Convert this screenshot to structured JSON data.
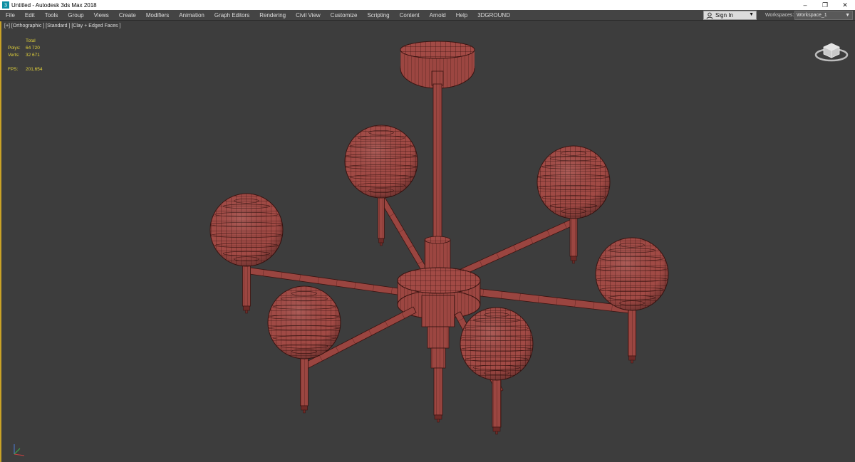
{
  "window": {
    "title": "Untitled - Autodesk 3ds Max 2018",
    "controls": [
      "–",
      "❐",
      "✕"
    ]
  },
  "menu": {
    "items": [
      "File",
      "Edit",
      "Tools",
      "Group",
      "Views",
      "Create",
      "Modifiers",
      "Animation",
      "Graph Editors",
      "Rendering",
      "Civil View",
      "Customize",
      "Scripting",
      "Content",
      "Arnold",
      "Help",
      "3DGROUND"
    ],
    "signin_label": "Sign In",
    "workspaces_label": "Workspaces:",
    "workspace_value": "Workspace_1"
  },
  "viewport": {
    "label": "[+] [Orthographic ] [Standard ] [Clay + Edged Faces ]",
    "stats": {
      "total_label": "Total",
      "polys_label": "Polys:",
      "polys_value": "64 720",
      "verts_label": "Verts:",
      "verts_value": "32 671",
      "fps_label": "FPS:",
      "fps_value": "201,654"
    }
  },
  "colors": {
    "mesh_fill": "#a24a45",
    "mesh_dark": "#6e2a27",
    "wire": "#3a1411",
    "viewport_bg": "#3d3d3d",
    "active_border": "#c9a227",
    "stats_text": "#e2d23a"
  },
  "icons": {
    "app": "3dsmax-icon",
    "user": "user-icon",
    "viewcube": "viewcube-icon",
    "axis": "axis-tripod-icon"
  }
}
